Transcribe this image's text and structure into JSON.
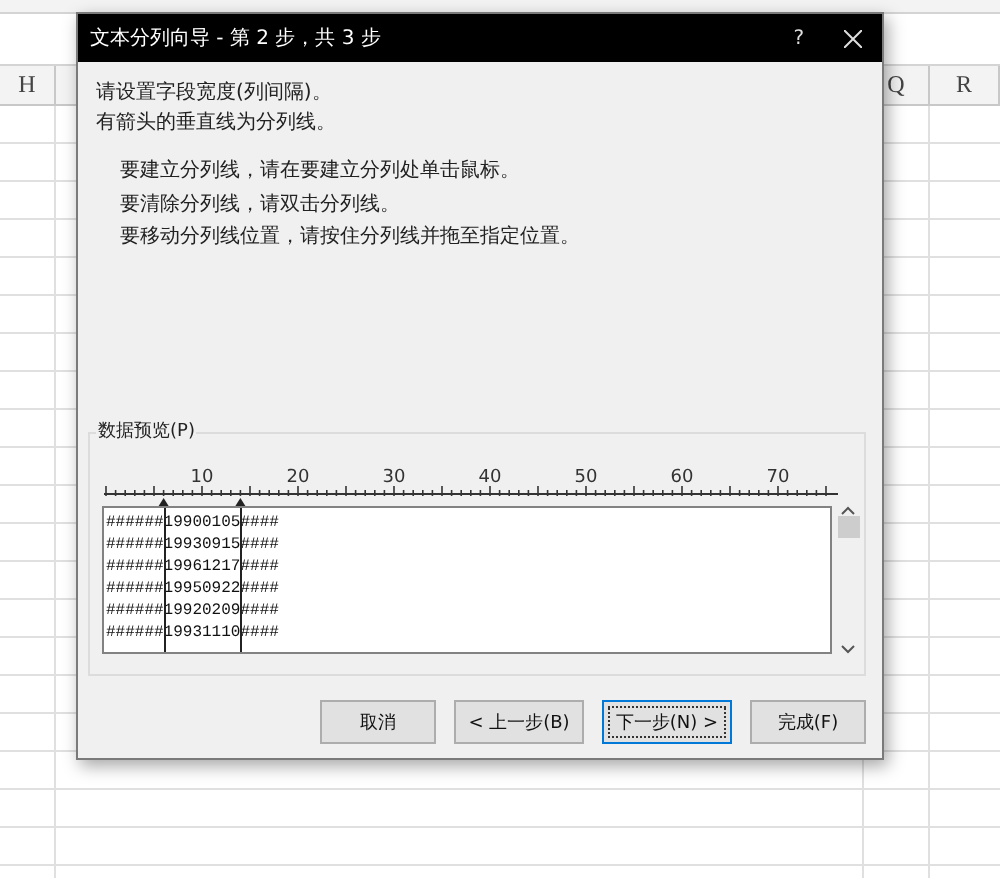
{
  "sheet": {
    "columns_left": [
      "H"
    ],
    "columns_right": [
      "Q",
      "R"
    ]
  },
  "dialog": {
    "title": "文本分列向导 - 第 2 步，共 3 步",
    "help": "?",
    "intro": [
      "请设置字段宽度(列间隔)。",
      "有箭头的垂直线为分列线。"
    ],
    "instructions": [
      "要建立分列线，请在要建立分列处单击鼠标。",
      "要清除分列线，请双击分列线。",
      "要移动分列线位置，请按住分列线并拖至指定位置。"
    ],
    "preview": {
      "label": "数据预览(P)",
      "ruler": [
        "10",
        "20",
        "30",
        "40",
        "50",
        "60",
        "70"
      ],
      "rows": [
        "######19900105####",
        "######19930915####",
        "######19961217####",
        "######19950922####",
        "######19920209####",
        "######19931110####"
      ]
    },
    "buttons": [
      {
        "label": "取消",
        "default": false
      },
      {
        "label": "< 上一步(B)",
        "default": false
      },
      {
        "label": "下一步(N) >",
        "default": true
      },
      {
        "label": "完成(F)",
        "default": false
      }
    ]
  }
}
